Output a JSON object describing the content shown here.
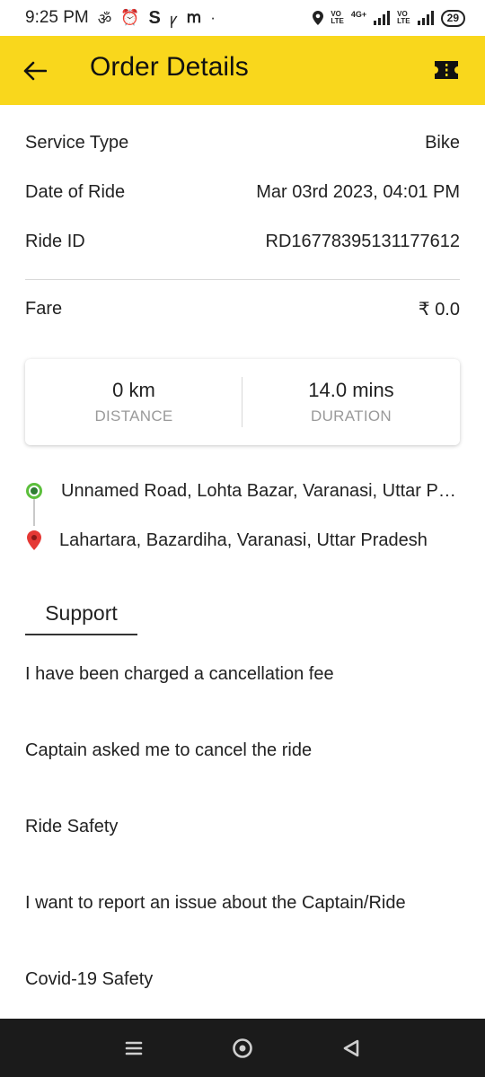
{
  "status_bar": {
    "time": "9:25 PM",
    "left_glyphs": [
      "ॐ",
      "⏰",
      "S",
      "ꝩ",
      "ⅿ",
      "·"
    ],
    "network_labels": [
      "VO",
      "LTE"
    ],
    "network_4g": "4G+",
    "battery": "29"
  },
  "header": {
    "title": "Order Details",
    "accent": "#f9d71c"
  },
  "details": [
    {
      "label": "Service Type",
      "value": "Bike"
    },
    {
      "label": "Date of Ride",
      "value": "Mar 03rd 2023, 04:01 PM"
    },
    {
      "label": "Ride ID",
      "value": "RD16778395131177612"
    }
  ],
  "fare": {
    "label": "Fare",
    "value": "₹ 0.0"
  },
  "stats": {
    "distance_value": "0 km",
    "distance_label": "DISTANCE",
    "duration_value": "14.0 mins",
    "duration_label": "DURATION"
  },
  "locations": {
    "pickup": "Unnamed Road, Lohta Bazar, Varanasi, Uttar Pradesh",
    "drop": "Lahartara, Bazardiha, Varanasi, Uttar Pradesh"
  },
  "support": {
    "tab_label": "Support",
    "items": [
      "I have been charged a cancellation fee",
      "Captain asked me to cancel the ride",
      "Ride Safety",
      "I want to report an issue about the Captain/Ride",
      "Covid-19 Safety"
    ]
  }
}
